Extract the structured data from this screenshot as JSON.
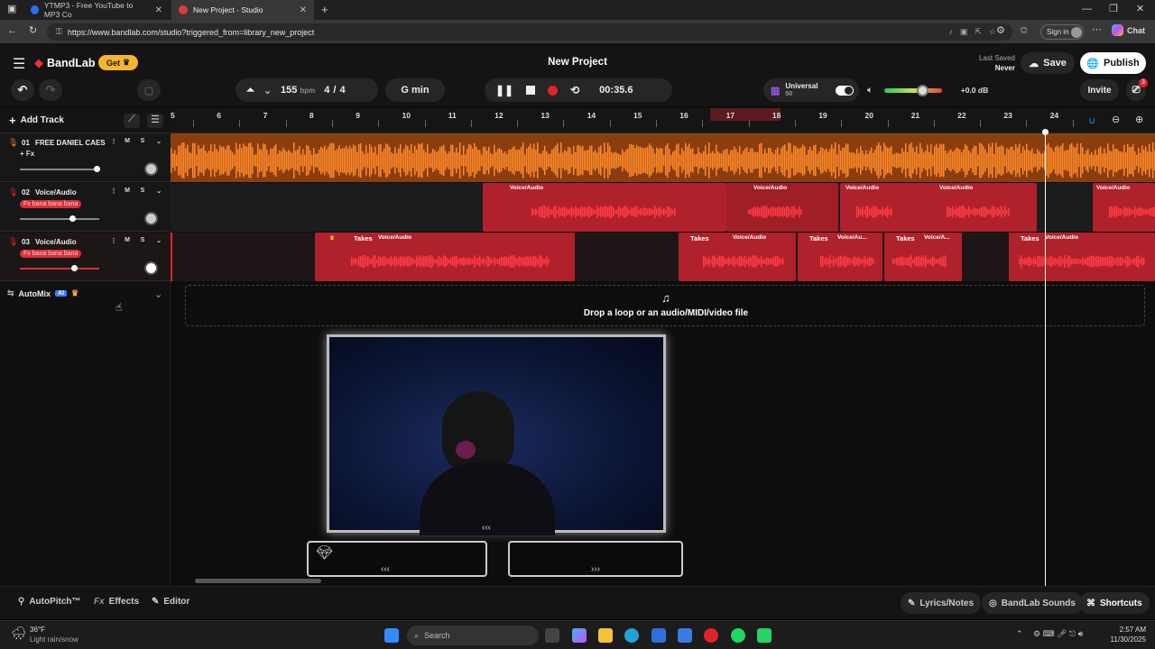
{
  "browser": {
    "tabs": [
      {
        "title": "YTMP3 - Free YouTube to MP3 Co"
      },
      {
        "title": "New Project - Studio"
      }
    ],
    "url": "https://www.bandlab.com/studio?triggered_from=library_new_project",
    "sign_in": "Sign in",
    "chat": "Chat"
  },
  "app": {
    "brand": "BandLab",
    "get_label": "Get",
    "project_title": "New Project",
    "last_saved_label": "Last Saved",
    "last_saved_value": "Never",
    "save": "Save",
    "publish": "Publish",
    "invite": "Invite",
    "notif_count": "3"
  },
  "transport": {
    "bpm": "155",
    "bpm_unit": "bpm",
    "time_sig_num": "4",
    "time_sig_den": "4",
    "key": "G min",
    "time": "00:35.6",
    "preset_name": "Universal",
    "preset_value": "50",
    "volume": "+0.0 dB"
  },
  "ruler": {
    "add_track": "Add Track",
    "bars": [
      "5",
      "6",
      "7",
      "8",
      "9",
      "10",
      "11",
      "12",
      "13",
      "14",
      "15",
      "16",
      "17",
      "18",
      "19",
      "20",
      "21",
      "22",
      "23",
      "24"
    ]
  },
  "tracks": [
    {
      "num": "01",
      "name": "FREE DANIEL CAES...",
      "fx": "+ Fx",
      "color": "#f07822"
    },
    {
      "num": "02",
      "name": "Voice/Audio",
      "fx": "Fx bana bana bana",
      "color": "#c4262e"
    },
    {
      "num": "03",
      "name": "Voice/Audio",
      "fx": "Fx bana bana bana",
      "color": "#c4262e"
    }
  ],
  "mute": "M",
  "solo": "S",
  "clips": {
    "voice": "Voice/Audio",
    "voice_short": "Voice/Au...",
    "voice_short2": "Voice/A...",
    "takes": "Takes"
  },
  "automix": {
    "label": "AutoMix",
    "ai": "AI"
  },
  "dropzone": "Drop a loop or an audio/MIDI/video file",
  "bottom": {
    "autopitch": "AutoPitch™",
    "effects": "Effects",
    "editor": "Editor",
    "lyrics": "Lyrics/Notes",
    "sounds": "BandLab Sounds",
    "shortcuts": "Shortcuts"
  },
  "taskbar": {
    "temp": "36°F",
    "weather": "Light rain/snow",
    "search": "Search",
    "time": "2:57 AM",
    "date": "11/30/2025"
  }
}
